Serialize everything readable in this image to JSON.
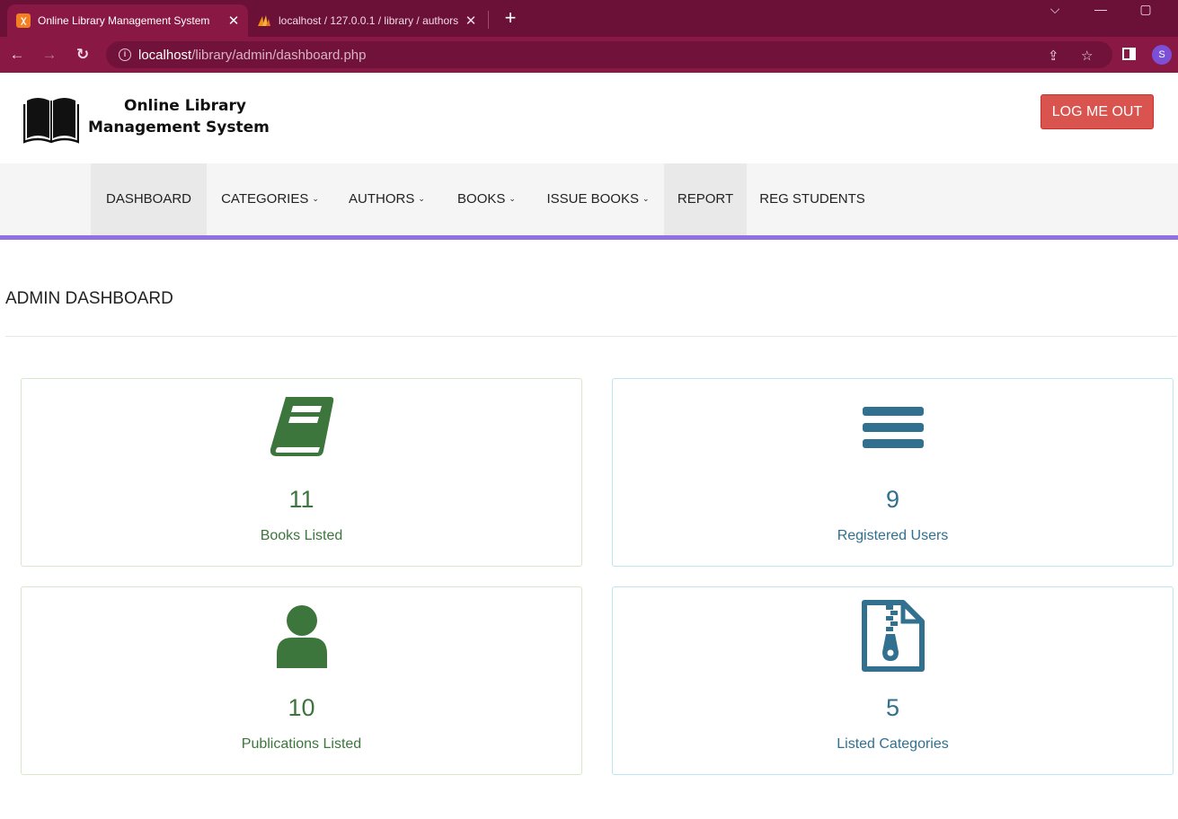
{
  "browser": {
    "tabs": [
      {
        "title": "Online Library Management System",
        "favicon": "xampp-icon"
      },
      {
        "title": "localhost / 127.0.0.1 / library / authors",
        "favicon": "phpmyadmin-icon"
      }
    ],
    "url_host": "localhost",
    "url_path": "/library/admin/dashboard.php",
    "profile_initial": "S",
    "colors": {
      "tabbar": "#6b1037",
      "toolbar": "#8a1844"
    }
  },
  "header": {
    "brand_line1": "Online Library",
    "brand_line2": "Management System",
    "logout_label": "LOG ME OUT",
    "logout_color": "#d9534f"
  },
  "nav": {
    "items": [
      {
        "label": "DASHBOARD"
      },
      {
        "label": "CATEGORIES",
        "caret": "⌄"
      },
      {
        "label": "AUTHORS",
        "caret": "⌄"
      },
      {
        "label": "BOOKS",
        "caret": "⌄"
      },
      {
        "label": "ISSUE BOOKS",
        "caret": "⌄"
      },
      {
        "label": "REPORT"
      },
      {
        "label": "REG STUDENTS"
      }
    ],
    "accent_color": "#9170e0"
  },
  "main": {
    "title": "ADMIN DASHBOARD",
    "cards": [
      {
        "value": "11",
        "label": "Books Listed",
        "icon": "book-icon",
        "color": "#3c763d"
      },
      {
        "value": "9",
        "label": "Registered Users",
        "icon": "bars-icon",
        "color": "#31708f"
      },
      {
        "value": "10",
        "label": "Publications Listed",
        "icon": "user-icon",
        "color": "#3c763d"
      },
      {
        "value": "5",
        "label": "Listed Categories",
        "icon": "file-archive-icon",
        "color": "#31708f"
      }
    ]
  }
}
